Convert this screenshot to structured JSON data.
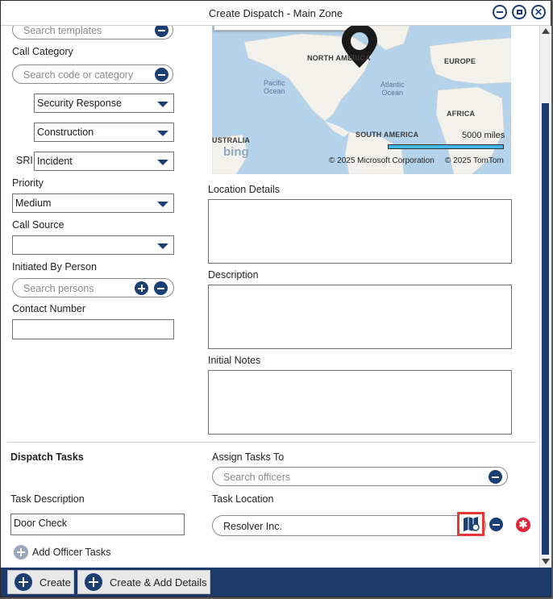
{
  "window": {
    "title": "Create Dispatch - Main Zone"
  },
  "left": {
    "search_templates_placeholder": "Search templates",
    "call_category_label": "Call Category",
    "call_category_placeholder": "Search code or category",
    "category_level1": "Security Response",
    "category_level2": "Construction",
    "sri_label": "SRI",
    "sri_value": "Incident",
    "priority_label": "Priority",
    "priority_value": "Medium",
    "call_source_label": "Call Source",
    "call_source_value": "",
    "initiated_by_label": "Initiated By Person",
    "initiated_by_placeholder": "Search persons",
    "contact_number_label": "Contact Number",
    "contact_number_value": ""
  },
  "map": {
    "labels": {
      "north_america": "NORTH AMERICA",
      "europe": "EUROPE",
      "pacific": "Pacific\nOcean",
      "atlantic": "Atlantic\nOcean",
      "africa": "AFRICA",
      "south_america": "SOUTH AMERICA",
      "australia": "USTRALIA"
    },
    "scale_text": "5000 miles",
    "logo": "bing",
    "copyright_ms": "© 2025 Microsoft Corporation",
    "copyright_tomtom": "© 2025 TomTom",
    "colors": {
      "water": "#b4d3ea",
      "land": "#f3f1ec",
      "scale": "#3fb7e8"
    }
  },
  "right": {
    "location_details_label": "Location Details",
    "description_label": "Description",
    "initial_notes_label": "Initial Notes"
  },
  "tasks": {
    "section_title": "Dispatch Tasks",
    "assign_label": "Assign Tasks To",
    "assign_placeholder": "Search officers",
    "task_description_label": "Task Description",
    "task_description_value": "Door Check",
    "task_location_label": "Task Location",
    "task_location_value": "Resolver Inc.",
    "add_officer_tasks": "Add Officer Tasks"
  },
  "footer": {
    "create_label": "Create",
    "create_add_details_label": "Create & Add Details"
  },
  "colors": {
    "accent": "#1c3f73",
    "footer": "#1b3a6b",
    "highlight": "#e53935",
    "delete": "#e0263a"
  }
}
